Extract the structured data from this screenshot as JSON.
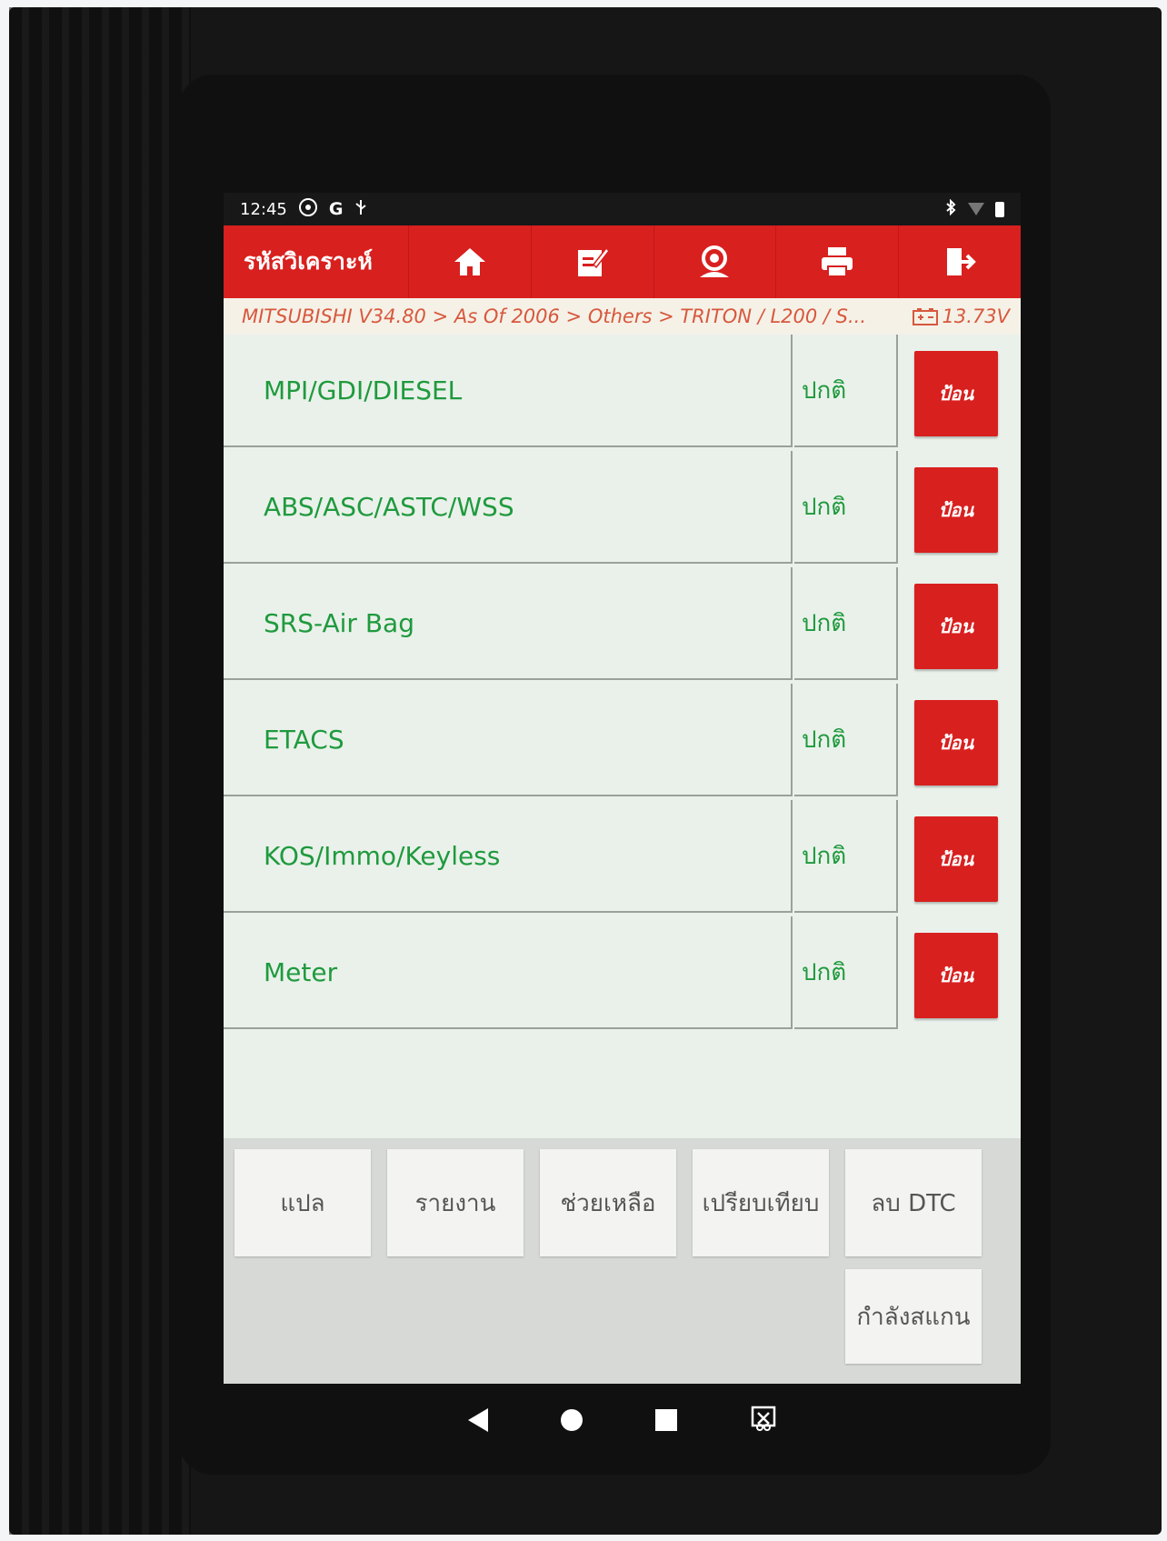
{
  "status_bar": {
    "time": "12:45",
    "left_icons": [
      "settings-icon",
      "google-icon",
      "usb-icon"
    ],
    "right_icons": [
      "bluetooth-icon",
      "wifi-icon",
      "battery-icon"
    ]
  },
  "app_bar": {
    "title": "รหัสวิเคราะห์",
    "toolbar_icons": [
      "home-icon",
      "edit-icon",
      "user-icon",
      "print-icon",
      "exit-icon"
    ],
    "accent_color": "#d8201f"
  },
  "breadcrumb": {
    "path": "MITSUBISHI V34.80 > As Of 2006 > Others > TRITON / L200 / S...",
    "voltage": "13.73V"
  },
  "systems": [
    {
      "name": "MPI/GDI/DIESEL",
      "status": "ปกติ",
      "action": "ป้อน"
    },
    {
      "name": "ABS/ASC/ASTC/WSS",
      "status": "ปกติ",
      "action": "ป้อน"
    },
    {
      "name": "SRS-Air Bag",
      "status": "ปกติ",
      "action": "ป้อน"
    },
    {
      "name": "ETACS",
      "status": "ปกติ",
      "action": "ป้อน"
    },
    {
      "name": "KOS/Immo/Keyless",
      "status": "ปกติ",
      "action": "ป้อน"
    },
    {
      "name": "Meter",
      "status": "ปกติ",
      "action": "ป้อน"
    }
  ],
  "bottom_buttons": {
    "translate": "แปล",
    "report": "รายงาน",
    "help": "ช่วยเหลือ",
    "compare": "เปรียบเทียบ",
    "clear_dtc": "ลบ DTC",
    "scanning": "กำลังสแกน"
  },
  "nav_icons": [
    "back-icon",
    "home-circle-icon",
    "recents-icon",
    "screenshot-icon"
  ]
}
